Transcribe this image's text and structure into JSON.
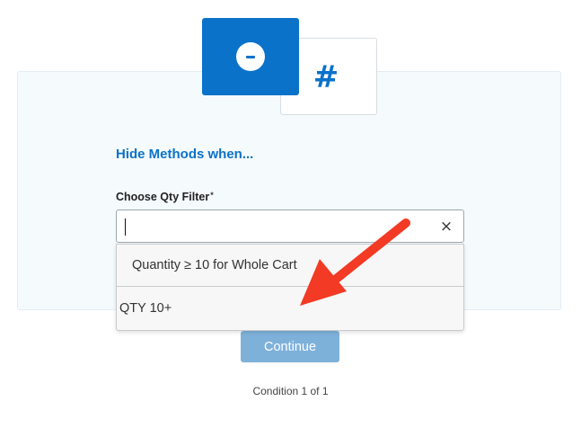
{
  "condition_types": [
    {
      "icon": "minus-circle-icon",
      "selected": true
    },
    {
      "icon": "hash-icon",
      "glyph": "#",
      "selected": false
    }
  ],
  "section": {
    "title": "Hide Methods when..."
  },
  "filter_field": {
    "label": "Choose Qty Filter",
    "required_marker": "*",
    "value": "",
    "clear_icon": "×"
  },
  "dropdown": {
    "options": [
      "Quantity ≥ 10 for Whole Cart",
      "QTY 10+"
    ]
  },
  "actions": {
    "continue_label": "Continue"
  },
  "footer": {
    "condition_counter": "Condition 1 of 1"
  },
  "annotation": {
    "arrow_color": "#f23a24"
  },
  "colors": {
    "accent": "#0b72c9",
    "button_disabled": "#7eb1da"
  }
}
